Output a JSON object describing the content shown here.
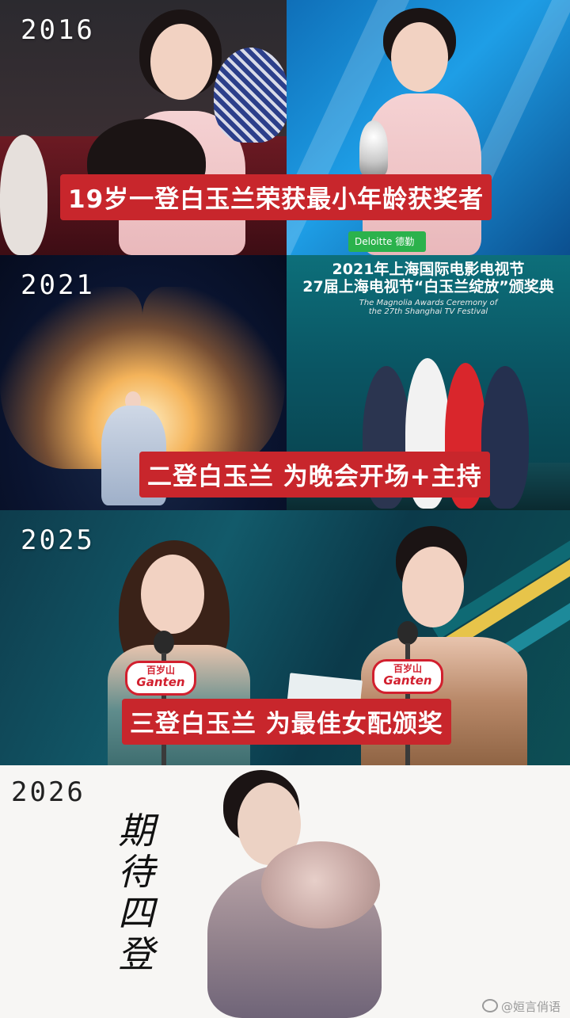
{
  "panels": [
    {
      "year": "2016",
      "caption": "19岁一登白玉兰荣获最小年龄获奖者",
      "badge": "Deloitte 德勤"
    },
    {
      "year": "2021",
      "caption": "二登白玉兰 为晚会开场+主持",
      "banner": {
        "line1": "2021年上海国际电影电视节",
        "line2": "27届上海电视节“白玉兰绽放”颁奖典",
        "line3": "The Magnolia Awards Ceremony of",
        "line4": "the 27th Shanghai TV Festival"
      }
    },
    {
      "year": "2025",
      "caption": "三登白玉兰 为最佳女配颁奖",
      "mic_plate": {
        "top": "百岁山",
        "brand": "Ganten"
      }
    },
    {
      "year": "2026",
      "signature": "期待四登"
    }
  ],
  "watermark": "@姮言俏语",
  "colors": {
    "caption_bg": "#c8262c",
    "caption_text": "#ffffff",
    "year_text_dark_panels": "#ffffff",
    "year_text_light_panel": "#222222"
  },
  "icons": [
    "weibo-icon"
  ]
}
